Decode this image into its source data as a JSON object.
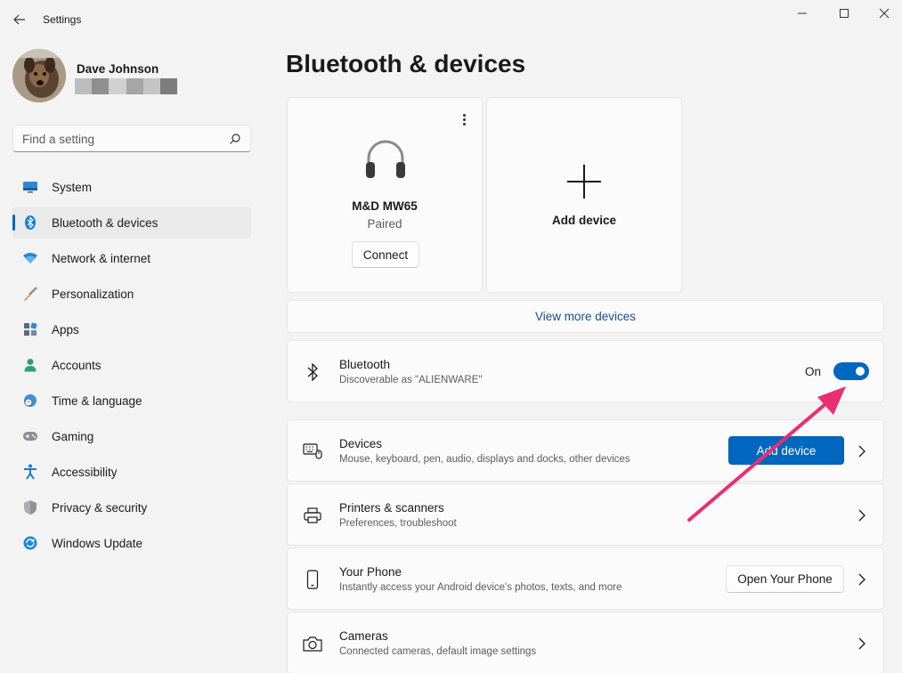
{
  "window": {
    "title": "Settings"
  },
  "profile": {
    "name": "Dave Johnson"
  },
  "search": {
    "placeholder": "Find a setting"
  },
  "sidebar": {
    "items": [
      {
        "label": "System",
        "icon": "system-icon"
      },
      {
        "label": "Bluetooth & devices",
        "icon": "bluetooth-icon",
        "active": true
      },
      {
        "label": "Network & internet",
        "icon": "wifi-icon"
      },
      {
        "label": "Personalization",
        "icon": "brush-icon"
      },
      {
        "label": "Apps",
        "icon": "apps-icon"
      },
      {
        "label": "Accounts",
        "icon": "person-icon"
      },
      {
        "label": "Time & language",
        "icon": "globe-clock-icon"
      },
      {
        "label": "Gaming",
        "icon": "gamepad-icon"
      },
      {
        "label": "Accessibility",
        "icon": "accessibility-icon"
      },
      {
        "label": "Privacy & security",
        "icon": "shield-icon"
      },
      {
        "label": "Windows Update",
        "icon": "update-icon"
      }
    ]
  },
  "main": {
    "title": "Bluetooth & devices",
    "device_card": {
      "name": "M&D MW65",
      "status": "Paired",
      "connect_label": "Connect"
    },
    "add_card": {
      "label": "Add device"
    },
    "view_more": "View more devices",
    "bluetooth": {
      "title": "Bluetooth",
      "subtitle": "Discoverable as \"ALIENWARE\"",
      "state": "On"
    },
    "rows": [
      {
        "title": "Devices",
        "subtitle": "Mouse, keyboard, pen, audio, displays and docks, other devices",
        "button": "Add device"
      },
      {
        "title": "Printers & scanners",
        "subtitle": "Preferences, troubleshoot"
      },
      {
        "title": "Your Phone",
        "subtitle": "Instantly access your Android device's photos, texts, and more",
        "button": "Open Your Phone"
      },
      {
        "title": "Cameras",
        "subtitle": "Connected cameras, default image settings"
      }
    ]
  },
  "colors": {
    "accent": "#0067c0",
    "annotation_arrow": "#ea2e72",
    "background": "#f3f3f3"
  }
}
